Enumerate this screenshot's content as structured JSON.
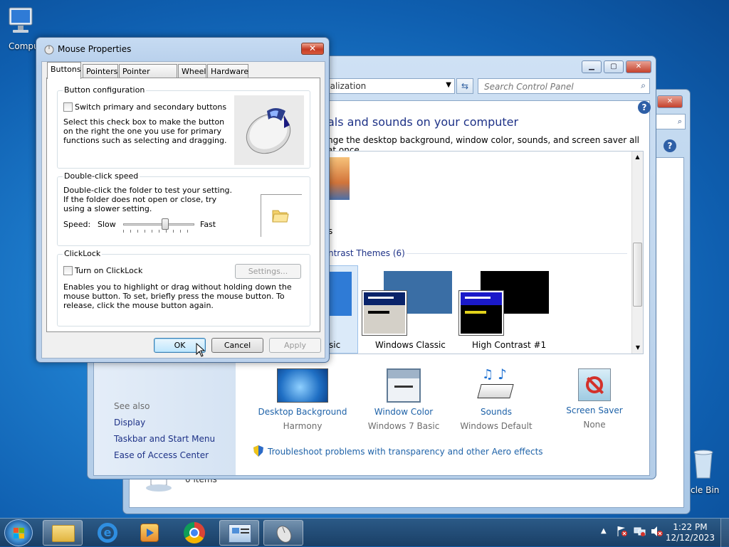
{
  "desktop": {
    "icons": [
      {
        "label": "Compu"
      },
      {
        "label": "cle Bin"
      }
    ]
  },
  "explorer_back": {
    "status": "0 items"
  },
  "control_panel": {
    "address": "nalization",
    "search_placeholder": "Search Control Panel",
    "heading": "als and sounds on your computer",
    "subheading": "nge the desktop background, window color, sounds, and screen saver all at once.",
    "theme_group_label": "ntrast Themes (6)",
    "theme_fragment_1": "s",
    "theme_fragment_2": "sic",
    "themes": [
      {
        "label": "Windows Classic"
      },
      {
        "label": "High Contrast #1"
      }
    ],
    "see_also": "See also",
    "links": [
      "Display",
      "Taskbar and Start Menu",
      "Ease of Access Center"
    ],
    "customize": [
      {
        "title": "Desktop Background",
        "value": "Harmony"
      },
      {
        "title": "Window Color",
        "value": "Windows 7 Basic"
      },
      {
        "title": "Sounds",
        "value": "Windows Default"
      },
      {
        "title": "Screen Saver",
        "value": "None"
      }
    ],
    "troubleshoot": "Troubleshoot problems with transparency and other Aero effects"
  },
  "dialog": {
    "title": "Mouse Properties",
    "close": "✕",
    "tabs": [
      "Buttons",
      "Pointers",
      "Pointer Options",
      "Wheel",
      "Hardware"
    ],
    "button_config": {
      "title": "Button configuration",
      "checkbox": "Switch primary and secondary buttons",
      "description": "Select this check box to make the button on the right the one you use for primary functions such as selecting and dragging."
    },
    "double_click": {
      "title": "Double-click speed",
      "description": "Double-click the folder to test your setting. If the folder does not open or close, try using a slower setting.",
      "speed_label": "Speed:",
      "slow": "Slow",
      "fast": "Fast",
      "speed_value": 0.6
    },
    "clicklock": {
      "title": "ClickLock",
      "checkbox": "Turn on ClickLock",
      "settings": "Settings...",
      "description": "Enables you to highlight or drag without holding down the mouse button. To set, briefly press the mouse button. To release, click the mouse button again."
    },
    "buttons": {
      "ok": "OK",
      "cancel": "Cancel",
      "apply": "Apply"
    }
  },
  "taskbar": {
    "time": "1:22 PM",
    "date": "12/12/2023"
  },
  "colors": {
    "link": "#1e3287",
    "heading": "#1e3287",
    "taskbar": "#1a3f66"
  }
}
